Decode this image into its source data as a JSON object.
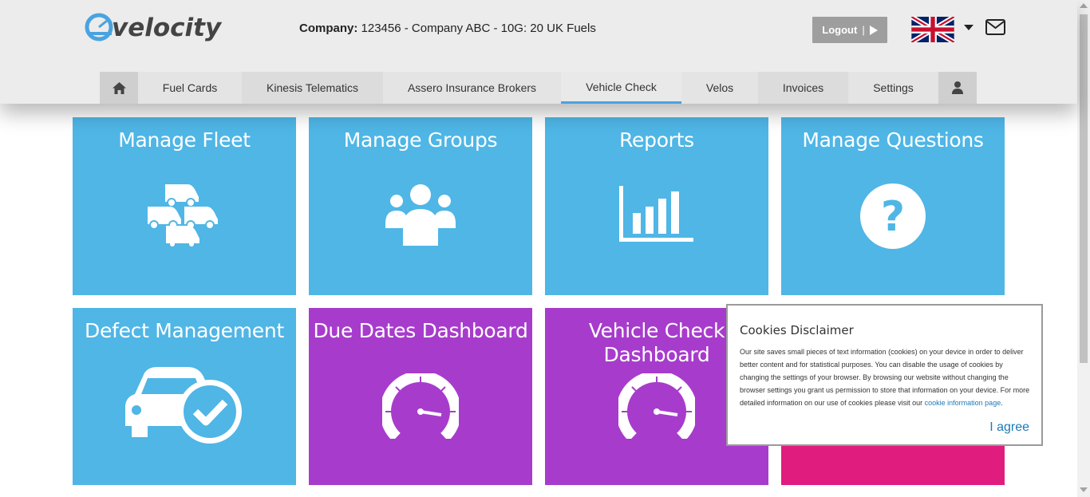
{
  "header": {
    "logo_text": "velocity",
    "company_label": "Company:",
    "company_value": "123456 - Company ABC - 10G: 20 UK Fuels",
    "logout_label": "Logout",
    "logout_separator": "|"
  },
  "nav": {
    "items": [
      {
        "label": "Fuel Cards"
      },
      {
        "label": "Kinesis Telematics"
      },
      {
        "label": "Assero Insurance Brokers"
      },
      {
        "label": "Vehicle Check"
      },
      {
        "label": "Velos"
      },
      {
        "label": "Invoices"
      },
      {
        "label": "Settings"
      }
    ],
    "active": "Vehicle Check"
  },
  "tiles": [
    {
      "title": "Manage Fleet",
      "icon": "vans-icon",
      "color": "#4fb6e6"
    },
    {
      "title": "Manage Groups",
      "icon": "users-group-icon",
      "color": "#4fb6e6"
    },
    {
      "title": "Reports",
      "icon": "bar-chart-icon",
      "color": "#4fb6e6"
    },
    {
      "title": "Manage Questions",
      "icon": "question-icon",
      "color": "#4fb6e6"
    },
    {
      "title": "Defect Management",
      "icon": "car-check-icon",
      "color": "#4fb6e6"
    },
    {
      "title": "Due Dates Dashboard",
      "icon": "speedometer-icon",
      "color": "#a73ccc"
    },
    {
      "title_line1": "Vehicle Check",
      "title_line2": "Dashboard",
      "icon": "speedometer-icon",
      "color": "#a73ccc"
    },
    {
      "title": "",
      "color": "#e01d7e"
    }
  ],
  "cookie": {
    "title": "Cookies Disclaimer",
    "body": "Our site saves small pieces of text information (cookies) on your device in order to deliver better content and for statistical purposes. You can disable the usage of cookies by changing the settings of your browser. By browsing our website without changing the browser settings you grant us permission to store that information on your device. For more detailed information on our use of cookies please visit our ",
    "link_text": "cookie information page",
    "link_suffix": ".",
    "agree_label": "I agree"
  },
  "colors": {
    "tile_blue": "#4fb6e6",
    "tile_purple": "#a73ccc",
    "tile_pink": "#e01d7e",
    "nav_active_underline": "#4aa3df",
    "link": "#1a7bb9"
  }
}
